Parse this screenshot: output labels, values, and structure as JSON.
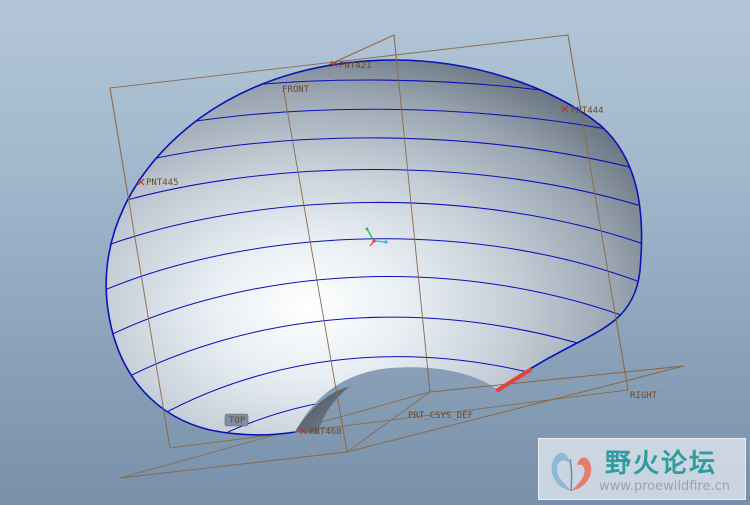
{
  "model": {
    "planes": {
      "front": "FRONT",
      "top": "TOP",
      "right": "RIGHT"
    },
    "csys": "PRT_CSYS_DEF",
    "points": [
      {
        "id": "pnt421",
        "label": "PNT421"
      },
      {
        "id": "pnt444",
        "label": "PNT444"
      },
      {
        "id": "pnt445",
        "label": "PNT445"
      },
      {
        "id": "pnt468",
        "label": "PNT468"
      }
    ]
  },
  "colors": {
    "background_top": "#b3c6d8",
    "background_bottom": "#7890aa",
    "surface_edges": "#0a12b8",
    "datum_planes": "#8a6a4a",
    "datum_labels": "#6b4a2a",
    "highlight_edge": "#e84040",
    "csys_x": "#e84040",
    "csys_y": "#20c040",
    "csys_z": "#30b8e8"
  },
  "watermark": {
    "title": "野火论坛",
    "url": "www.proewildfire.cn",
    "logo_icon": "butterfly-logo-icon"
  }
}
